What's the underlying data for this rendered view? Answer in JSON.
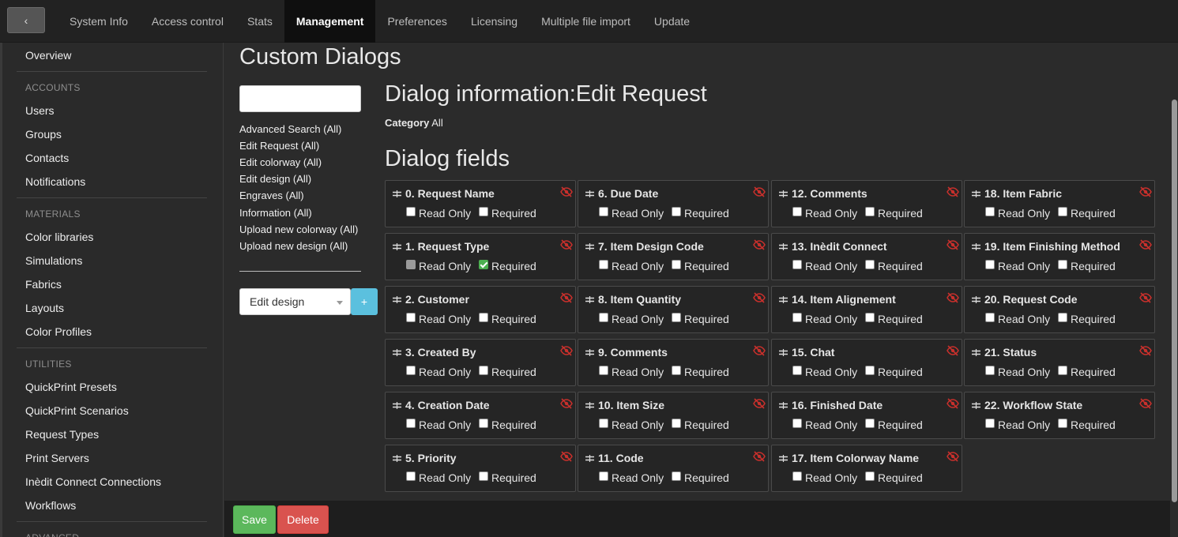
{
  "nav": {
    "back_label": "‹",
    "tabs": [
      {
        "label": "System Info",
        "active": false
      },
      {
        "label": "Access control",
        "active": false
      },
      {
        "label": "Stats",
        "active": false
      },
      {
        "label": "Management",
        "active": true
      },
      {
        "label": "Preferences",
        "active": false
      },
      {
        "label": "Licensing",
        "active": false
      },
      {
        "label": "Multiple file import",
        "active": false
      },
      {
        "label": "Update",
        "active": false
      }
    ]
  },
  "sidebar": {
    "overview": "Overview",
    "sections": [
      {
        "heading": "ACCOUNTS",
        "items": [
          "Users",
          "Groups",
          "Contacts",
          "Notifications"
        ]
      },
      {
        "heading": "MATERIALS",
        "items": [
          "Color libraries",
          "Simulations",
          "Fabrics",
          "Layouts",
          "Color Profiles"
        ]
      },
      {
        "heading": "UTILITIES",
        "items": [
          "QuickPrint Presets",
          "QuickPrint Scenarios",
          "Request Types",
          "Print Servers",
          "Inèdit Connect Connections",
          "Workflows"
        ]
      },
      {
        "heading": "ADVANCED",
        "items": []
      }
    ]
  },
  "main": {
    "title": "Custom Dialogs",
    "search_value": "",
    "dialogs": [
      "Advanced Search (All)",
      "Edit Request (All)",
      "Edit colorway (All)",
      "Edit design (All)",
      "Engraves (All)",
      "Information (All)",
      "Upload new colorway (All)",
      "Upload new design (All)"
    ],
    "select_value": "Edit design",
    "add_label": "+",
    "info_title": "Dialog information:Edit Request",
    "category_label": "Category",
    "category_value": "All",
    "fields_title": "Dialog fields",
    "read_only_label": "Read Only",
    "required_label": "Required",
    "fields": [
      {
        "name": "0. Request Name",
        "read_only": false,
        "required": false,
        "read_only_disabled": false
      },
      {
        "name": "1. Request Type",
        "read_only": false,
        "required": true,
        "read_only_disabled": true
      },
      {
        "name": "2. Customer",
        "read_only": false,
        "required": false,
        "read_only_disabled": false
      },
      {
        "name": "3. Created By",
        "read_only": false,
        "required": false,
        "read_only_disabled": false
      },
      {
        "name": "4. Creation Date",
        "read_only": false,
        "required": false,
        "read_only_disabled": false
      },
      {
        "name": "5. Priority",
        "read_only": false,
        "required": false,
        "read_only_disabled": false
      },
      {
        "name": "6. Due Date",
        "read_only": false,
        "required": false,
        "read_only_disabled": false
      },
      {
        "name": "7. Item Design Code",
        "read_only": false,
        "required": false,
        "read_only_disabled": false
      },
      {
        "name": "8. Item Quantity",
        "read_only": false,
        "required": false,
        "read_only_disabled": false
      },
      {
        "name": "9. Comments",
        "read_only": false,
        "required": false,
        "read_only_disabled": false
      },
      {
        "name": "10. Item Size",
        "read_only": false,
        "required": false,
        "read_only_disabled": false
      },
      {
        "name": "11. Code",
        "read_only": false,
        "required": false,
        "read_only_disabled": false
      },
      {
        "name": "12. Comments",
        "read_only": false,
        "required": false,
        "read_only_disabled": false
      },
      {
        "name": "13. Inèdit Connect",
        "read_only": false,
        "required": false,
        "read_only_disabled": false
      },
      {
        "name": "14. Item Alignement",
        "read_only": false,
        "required": false,
        "read_only_disabled": false
      },
      {
        "name": "15. Chat",
        "read_only": false,
        "required": false,
        "read_only_disabled": false
      },
      {
        "name": "16. Finished Date",
        "read_only": false,
        "required": false,
        "read_only_disabled": false
      },
      {
        "name": "17. Item Colorway Name",
        "read_only": false,
        "required": false,
        "read_only_disabled": false
      },
      {
        "name": "18. Item Fabric",
        "read_only": false,
        "required": false,
        "read_only_disabled": false
      },
      {
        "name": "19. Item Finishing Method",
        "read_only": false,
        "required": false,
        "read_only_disabled": false
      },
      {
        "name": "20. Request Code",
        "read_only": false,
        "required": false,
        "read_only_disabled": false
      },
      {
        "name": "21. Status",
        "read_only": false,
        "required": false,
        "read_only_disabled": false
      },
      {
        "name": "22. Workflow State",
        "read_only": false,
        "required": false,
        "read_only_disabled": false
      }
    ]
  },
  "footer": {
    "save_label": "Save",
    "delete_label": "Delete"
  },
  "colors": {
    "hidden_icon": "#c9302c",
    "save": "#5cb85c",
    "delete": "#d9534f",
    "add": "#5bc0de"
  },
  "icons": {
    "drag": "drag-handle-icon",
    "hidden": "eye-slash-icon",
    "back": "chevron-left-icon"
  }
}
